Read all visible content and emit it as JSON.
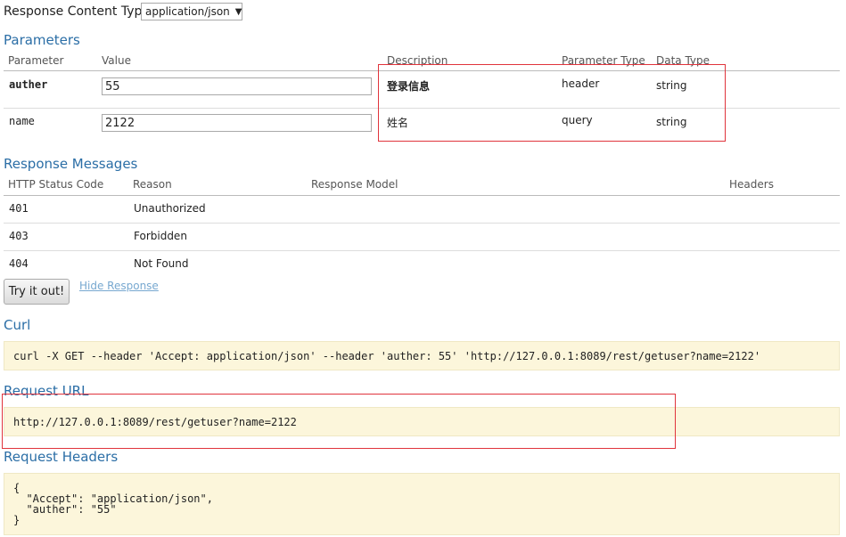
{
  "response_content_type": {
    "label": "Response Content Type",
    "selected": "application/json"
  },
  "parameters": {
    "title": "Parameters",
    "headers": [
      "Parameter",
      "Value",
      "Description",
      "Parameter Type",
      "Data Type"
    ],
    "rows": [
      {
        "name": "auther",
        "value": "55",
        "description": "登录信息",
        "param_type": "header",
        "data_type": "string"
      },
      {
        "name": "name",
        "value": "2122",
        "description": "姓名",
        "param_type": "query",
        "data_type": "string"
      }
    ]
  },
  "response_messages": {
    "title": "Response Messages",
    "headers": [
      "HTTP Status Code",
      "Reason",
      "Response Model",
      "Headers"
    ],
    "rows": [
      {
        "code": "401",
        "reason": "Unauthorized"
      },
      {
        "code": "403",
        "reason": "Forbidden"
      },
      {
        "code": "404",
        "reason": "Not Found"
      }
    ]
  },
  "actions": {
    "try_label": "Try it out!",
    "hide_label": "Hide Response"
  },
  "curl": {
    "title": "Curl",
    "command": "curl -X GET --header 'Accept: application/json' --header 'auther: 55' 'http://127.0.0.1:8089/rest/getuser?name=2122'"
  },
  "request_url": {
    "title": "Request URL",
    "url": "http://127.0.0.1:8089/rest/getuser?name=2122"
  },
  "request_headers": {
    "title": "Request Headers",
    "body": "{\n  \"Accept\": \"application/json\",\n  \"auther\": \"55\"\n}"
  },
  "colors": {
    "section_title": "#2b6ea6",
    "code_background": "#fcf6db",
    "annotation_box": "#e0343c",
    "link": "#77a8d0"
  }
}
